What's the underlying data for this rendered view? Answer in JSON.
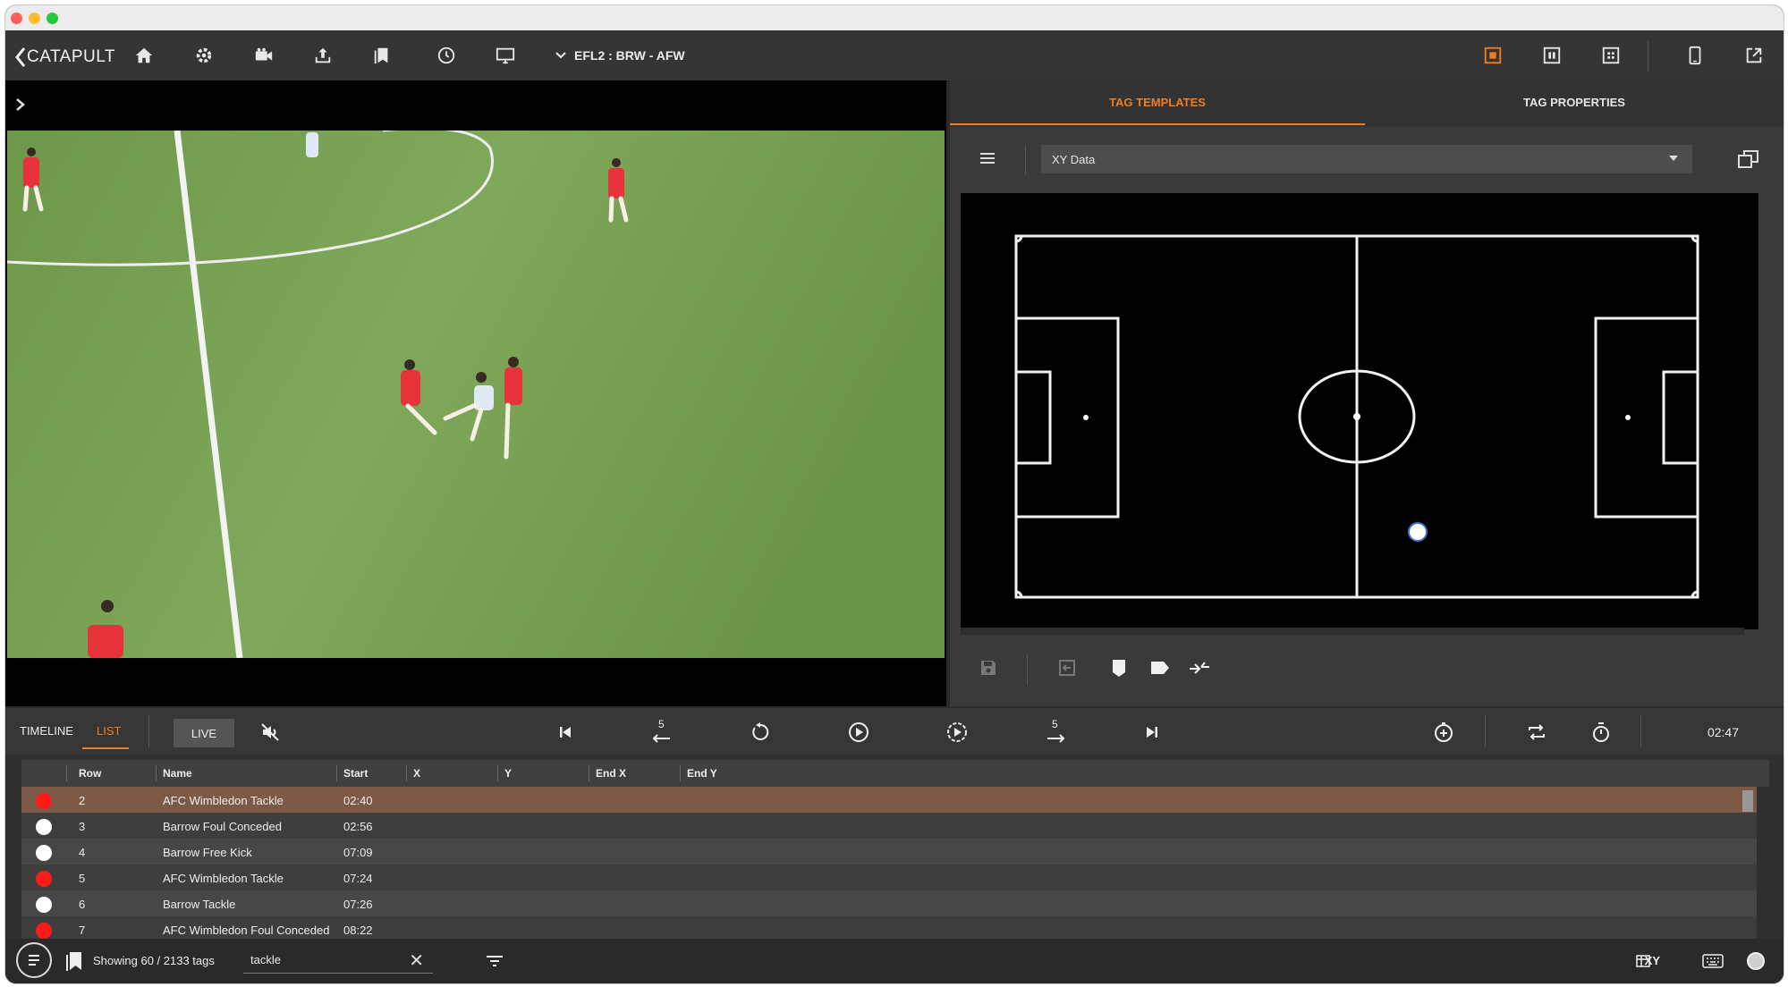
{
  "window": {
    "dots": [
      "#ff5f57",
      "#febc2e",
      "#28c840"
    ]
  },
  "toolbar": {
    "logo": "CATAPULT",
    "match_label": "EFL2 : BRW - AFW",
    "accent": "#f07d22"
  },
  "right_panel": {
    "tabs": [
      {
        "label": "TAG TEMPLATES",
        "active": true
      },
      {
        "label": "TAG PROPERTIES",
        "active": false
      }
    ],
    "template_select": "XY Data"
  },
  "lower": {
    "tabs": [
      {
        "label": "TIMELINE",
        "active": false
      },
      {
        "label": "LIST",
        "active": true
      }
    ],
    "live_label": "LIVE",
    "skip_back_label": "5",
    "skip_fwd_label": "5",
    "time": "02:47"
  },
  "table": {
    "columns": [
      "Row",
      "Name",
      "Start",
      "X",
      "Y",
      "End X",
      "End Y"
    ],
    "rows": [
      {
        "dot": "red",
        "row": "2",
        "name": "AFC Wimbledon Tackle",
        "start": "02:40",
        "selected": true
      },
      {
        "dot": "white",
        "row": "3",
        "name": "Barrow Foul Conceded",
        "start": "02:56"
      },
      {
        "dot": "white",
        "row": "4",
        "name": "Barrow Free Kick",
        "start": "07:09"
      },
      {
        "dot": "red",
        "row": "5",
        "name": "AFC Wimbledon Tackle",
        "start": "07:24"
      },
      {
        "dot": "white",
        "row": "6",
        "name": "Barrow Tackle",
        "start": "07:26"
      },
      {
        "dot": "red",
        "row": "7",
        "name": "AFC Wimbledon Foul Conceded",
        "start": "08:22"
      }
    ]
  },
  "status": {
    "showing": "Showing 60 / 2133 tags",
    "search_value": "tackle",
    "xy_label": "XY"
  }
}
